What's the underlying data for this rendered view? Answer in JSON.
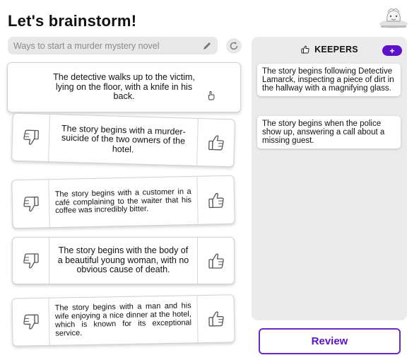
{
  "header": {
    "title": "Let's brainstorm!"
  },
  "search": {
    "placeholder": "Ways to start a murder mystery novel"
  },
  "ideas": {
    "current": "The detective walks up to the victim, lying on the floor, with a knife in his back.",
    "items": [
      "The story begins with a murder-suicide of the two owners of the hotel.",
      "The story begins with a customer in a café complaining to the waiter that his coffee was incredibly bitter.",
      "The story begins with the body of a beautiful young woman, with no obvious cause of death.",
      "The story begins with a man and his wife enjoying a nice dinner at the hotel, which is known for its exceptional service."
    ]
  },
  "keepers": {
    "title": "KEEPERS",
    "add_label": "+",
    "items": [
      "The story begins following Detective Lamarck, inspecting a piece of dirt in the hallway with a magnifying glass.",
      "The story begins when the police show up, answering a call about a missing guest."
    ]
  },
  "actions": {
    "review_label": "Review"
  },
  "colors": {
    "accent": "#5b12c9",
    "panel": "#ebebeb",
    "search_bg": "#e8e8e8"
  },
  "icons": [
    "avatar-icon",
    "pencil-icon",
    "refresh-icon",
    "thumbs-down-icon",
    "thumbs-up-icon",
    "cursor-hand-icon",
    "plus-icon"
  ]
}
